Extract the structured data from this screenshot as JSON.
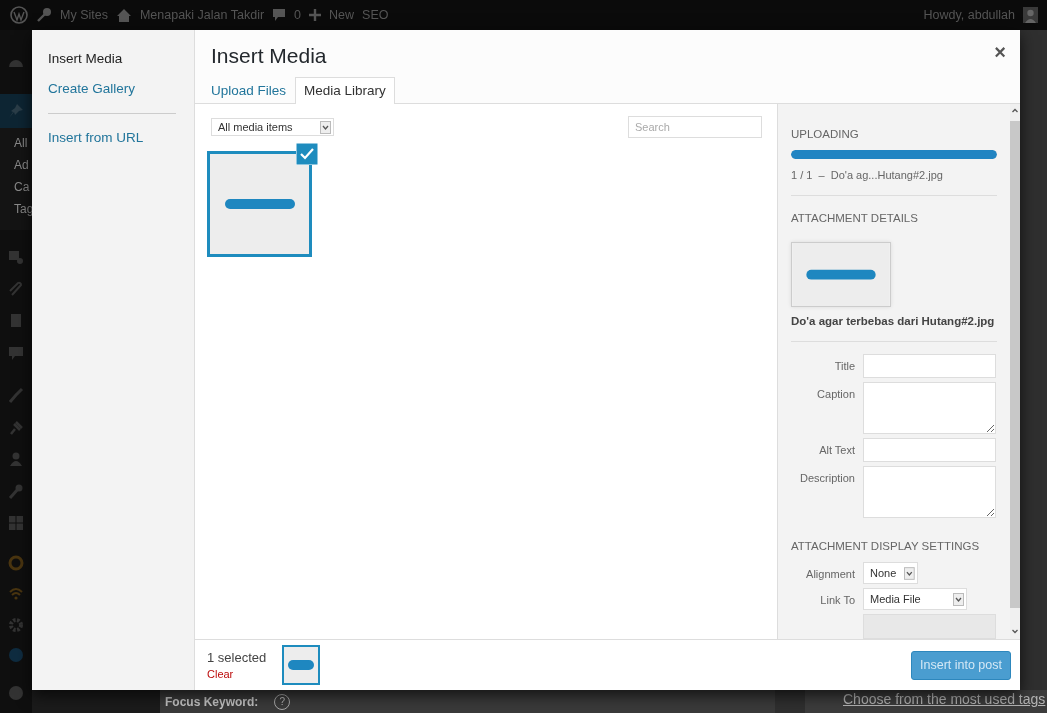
{
  "admin_bar": {
    "my_sites": "My Sites",
    "site_name": "Menapaki Jalan Takdir",
    "comments": "0",
    "new": "New",
    "seo": "SEO",
    "greeting": "Howdy, abdullah"
  },
  "admin_menu": {
    "items": [
      "All",
      "Ad",
      "Ca",
      "Tag"
    ]
  },
  "background": {
    "focus_keyword": "Focus Keyword:",
    "help": "?",
    "tags_link": "Choose from the most used tags"
  },
  "modal": {
    "title": "Insert Media",
    "close": "×",
    "menu": [
      {
        "label": "Insert Media",
        "selected": true,
        "separator_before": false
      },
      {
        "label": "Create Gallery",
        "selected": false,
        "separator_before": false
      },
      {
        "label": "Insert from URL",
        "selected": false,
        "separator_before": true
      }
    ],
    "tabs": [
      {
        "label": "Upload Files",
        "selected": false
      },
      {
        "label": "Media Library",
        "selected": true
      }
    ],
    "filter": {
      "value": "All media items"
    },
    "search": {
      "placeholder": "Search"
    },
    "attachments": [
      {
        "selected": true
      }
    ],
    "sidebar": {
      "uploading": {
        "heading": "UPLOADING",
        "level": 1,
        "status": "1 / 1  –  Do'a ag...Hutang#2.jpg"
      },
      "details": {
        "heading": "ATTACHMENT DETAILS",
        "filename": "Do'a agar terbebas dari Hutang#2.jpg",
        "fields": [
          {
            "label": "Title",
            "kind": "input"
          },
          {
            "label": "Caption",
            "kind": "textarea"
          },
          {
            "label": "Alt Text",
            "kind": "input"
          },
          {
            "label": "Description",
            "kind": "textarea"
          }
        ]
      },
      "display": {
        "heading": "ATTACHMENT DISPLAY SETTINGS",
        "alignment": {
          "label": "Alignment",
          "value": "None"
        },
        "link_to": {
          "label": "Link To",
          "value": "Media File"
        },
        "url_disabled": true
      }
    },
    "selection": {
      "count": "1 selected",
      "clear": "Clear"
    },
    "primary_button": {
      "label": "Insert into post"
    }
  }
}
